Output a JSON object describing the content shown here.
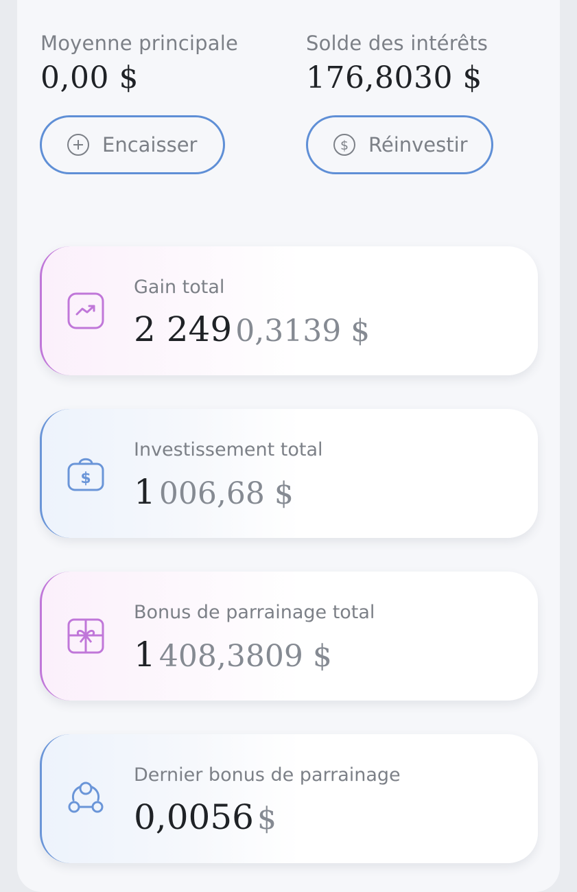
{
  "balances": {
    "principal": {
      "label": "Moyenne principale",
      "value": "0,00 $"
    },
    "interest": {
      "label": "Solde des intérêts",
      "value": "176,8030 $"
    }
  },
  "actions": {
    "cashout": {
      "label": "Encaisser",
      "icon": "plus-circle-icon"
    },
    "reinvest": {
      "label": "Réinvestir",
      "icon": "dollar-circle-icon"
    }
  },
  "stats": [
    {
      "label": "Gain total",
      "value_major": "2 249",
      "value_minor": "0,3139 $",
      "icon": "trend-up-icon",
      "accent": "#c077d9"
    },
    {
      "label": "Investissement total",
      "value_major": "1",
      "value_minor": "006,68 $",
      "icon": "money-bag-icon",
      "accent": "#6a95d8"
    },
    {
      "label": "Bonus de parrainage total",
      "value_major": "1",
      "value_minor": "408,3809 $",
      "icon": "gift-icon",
      "accent": "#c077d9"
    },
    {
      "label": "Dernier bonus de parrainage",
      "value_major": "0,0056",
      "value_minor": "$",
      "icon": "referral-network-icon",
      "accent": "#6a95d8"
    }
  ],
  "colors": {
    "button_border": "#5f8fd6",
    "pink_accent": "#c077d9",
    "blue_accent": "#6a95d8",
    "text_dark": "#1f2226",
    "text_muted": "#7c8087"
  }
}
